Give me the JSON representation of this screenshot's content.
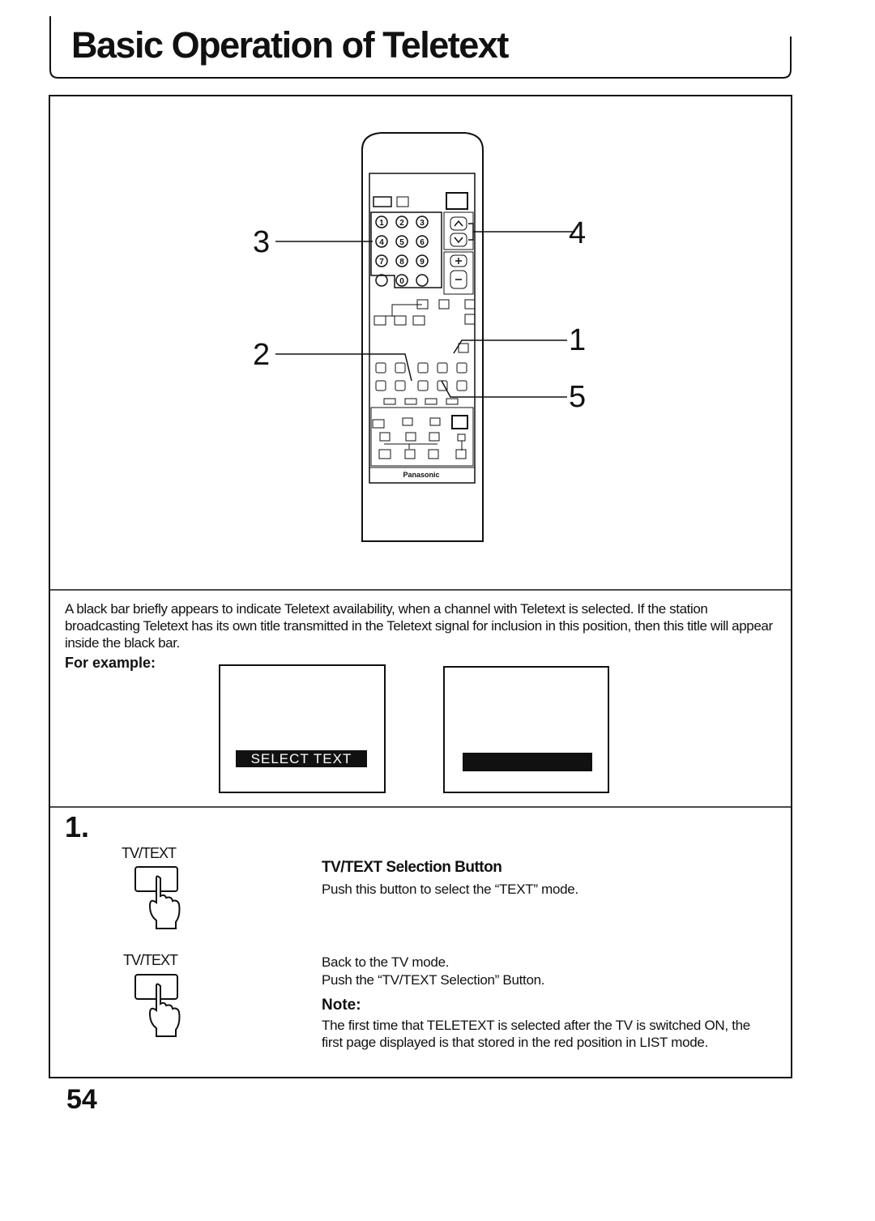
{
  "title": "Basic Operation of Teletext",
  "callouts": [
    "3",
    "4",
    "2",
    "1",
    "5"
  ],
  "remote": {
    "digits": [
      "1",
      "2",
      "3",
      "4",
      "5",
      "6",
      "7",
      "8",
      "9",
      "0"
    ],
    "brand": "Panasonic"
  },
  "intro": "A black bar briefly appears to indicate Teletext availability, when a channel with Teletext is selected. If the station broadcasting Teletext has its own title transmitted in the Teletext signal for inclusion in this position, then this title will appear inside the black bar.",
  "for_example": "For example:",
  "screen_bar_text": "SELECT TEXT",
  "step": {
    "number": "1.",
    "button_label_1": "TV/TEXT",
    "button_label_2": "TV/TEXT",
    "heading": "TV/TEXT Selection Button",
    "instruction": "Push this button to select the “TEXT” mode.",
    "back_line1": "Back to the TV mode.",
    "back_line2": "Push the “TV/TEXT Selection” Button.",
    "note_heading": "Note:",
    "note_text": "The first time that TELETEXT is selected after the TV is switched ON, the first page displayed is that stored in the red position in LIST mode."
  },
  "page_number": "54"
}
